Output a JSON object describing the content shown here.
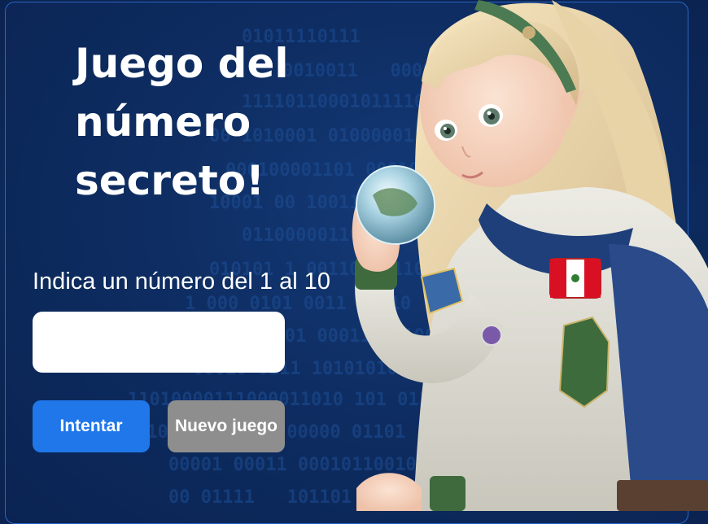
{
  "page": {
    "title": "Juego del número secreto!",
    "prompt": "Indica un número del 1 al 10",
    "input_value": "",
    "input_placeholder": "",
    "buttons": {
      "try_label": "Intentar",
      "new_game_label": "Nuevo juego"
    }
  },
  "background": {
    "binary_rows": [
      "01011110111",
      "0010011   0000010  1010",
      "111101100010111101   10",
      "00 1010001 0100000111011",
      "000100001101 0001011011",
      "10001 00 10011   11 1",
      "011000001101000 0011",
      "010101 1 00110 001100010",
      "1 000 0101 0011 01010",
      "1100 1001 00011001100",
      "00010 0111 1010101000",
      "11010000111000011010 101 01100",
      "1100 01011010 00000 01101  0001100000",
      "00001 00011 000101100101100001011",
      "00 01111   101101 00011101100"
    ]
  },
  "colors": {
    "accent": "#1f77ea",
    "secondary": "#8e8e8e",
    "background": "#0c2a5c",
    "frame_border": "#2a66c8"
  },
  "illustration": {
    "subject": "astronaut-girl-holding-globe",
    "patch_flag": "peru-flag"
  }
}
